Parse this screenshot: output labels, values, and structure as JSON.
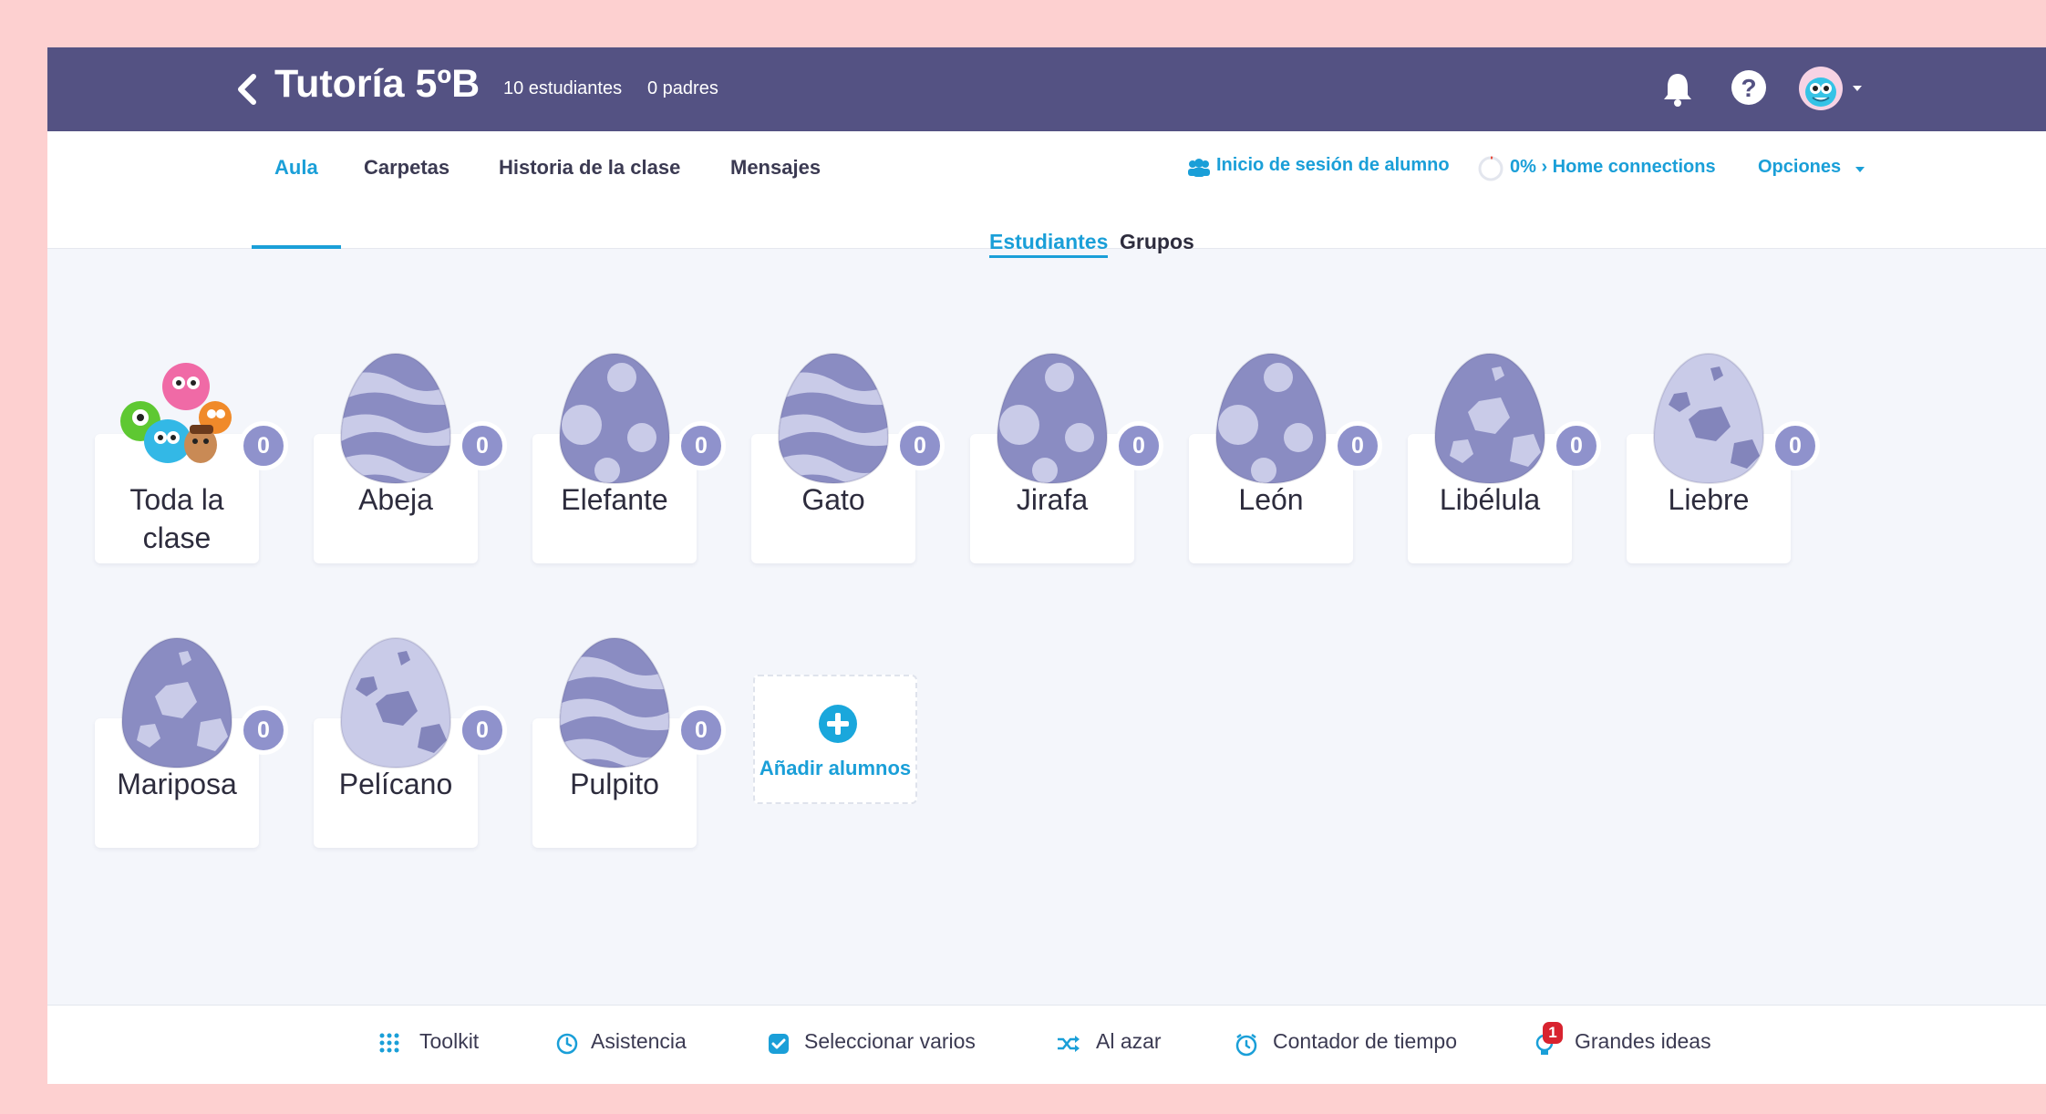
{
  "header": {
    "class_title": "Tutoría 5ºB",
    "students_count": "10 estudiantes",
    "parents_count": "0 padres"
  },
  "tabs": [
    {
      "label": "Aula",
      "active": true
    },
    {
      "label": "Carpetas"
    },
    {
      "label": "Historia de la clase"
    },
    {
      "label": "Mensajes"
    }
  ],
  "tabbar_right": {
    "student_login": "Inicio de sesión de alumno",
    "home_connections": "0% › Home connections",
    "options": "Opciones"
  },
  "view_toggle": {
    "students": "Estudiantes",
    "groups": "Grupos"
  },
  "whole_class": {
    "name_line1": "Toda la",
    "name_line2": "clase",
    "points": "0"
  },
  "students": [
    {
      "name": "Abeja",
      "points": "0",
      "egg": "wave"
    },
    {
      "name": "Elefante",
      "points": "0",
      "egg": "spots"
    },
    {
      "name": "Gato",
      "points": "0",
      "egg": "wave"
    },
    {
      "name": "Jirafa",
      "points": "0",
      "egg": "spots"
    },
    {
      "name": "León",
      "points": "0",
      "egg": "spots"
    },
    {
      "name": "Libélula",
      "points": "0",
      "egg": "hex"
    },
    {
      "name": "Liebre",
      "points": "0",
      "egg": "hex-light"
    },
    {
      "name": "Mariposa",
      "points": "0",
      "egg": "hex"
    },
    {
      "name": "Pelícano",
      "points": "0",
      "egg": "hex-light"
    },
    {
      "name": "Pulpito",
      "points": "0",
      "egg": "wave"
    }
  ],
  "add_students": "Añadir alumnos",
  "toolbar": {
    "toolkit": "Toolkit",
    "attendance": "Asistencia",
    "select_multiple": "Seleccionar varios",
    "random": "Al azar",
    "timer": "Contador de tiempo",
    "big_ideas": "Grandes ideas",
    "big_ideas_badge": "1"
  },
  "colors": {
    "header_bg": "#545283",
    "accent": "#1a9fd8",
    "badge": "#8f92cc",
    "egg_dark": "#8385bb",
    "egg_light": "#c9cbe8",
    "page_bg": "#f4f6fb"
  }
}
